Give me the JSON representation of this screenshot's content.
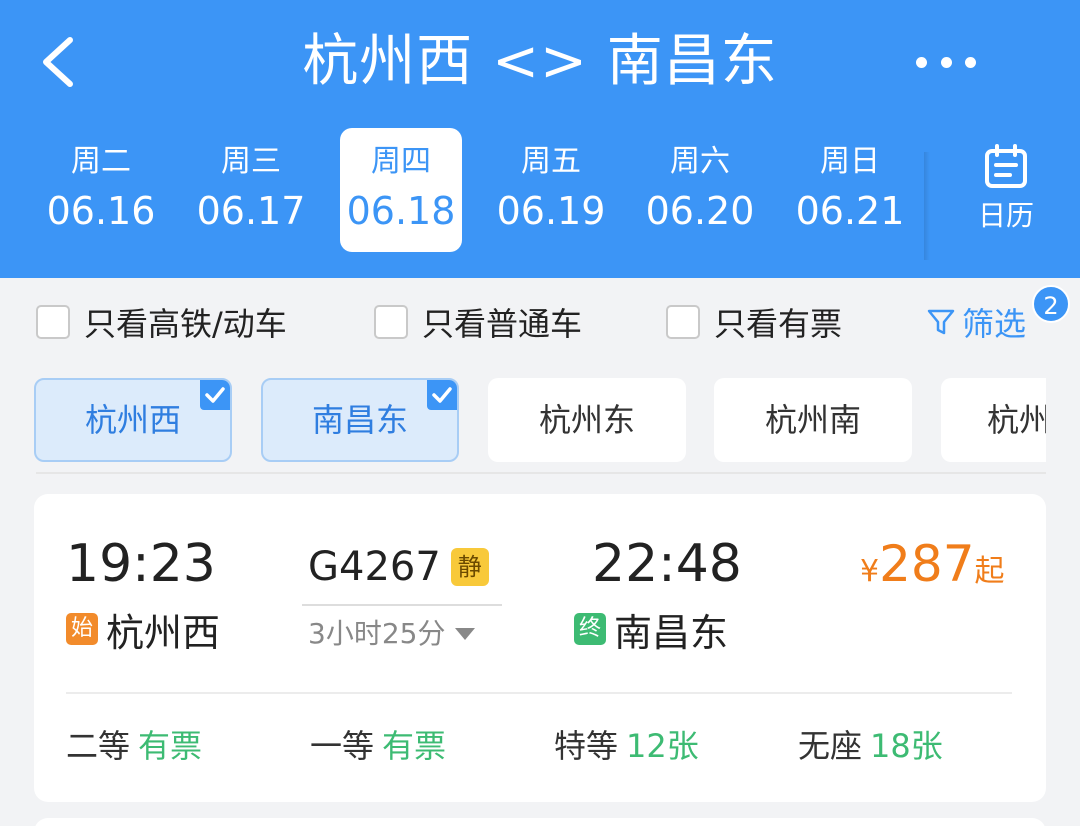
{
  "header": {
    "title": "杭州西 <> 南昌东",
    "back_icon": "chevron-left-icon",
    "more_icon": "more-horizontal-icon"
  },
  "dates": [
    {
      "weekday": "周二",
      "date": "06.16",
      "active": false
    },
    {
      "weekday": "周三",
      "date": "06.17",
      "active": false
    },
    {
      "weekday": "周四",
      "date": "06.18",
      "active": true
    },
    {
      "weekday": "周五",
      "date": "06.19",
      "active": false
    },
    {
      "weekday": "周六",
      "date": "06.20",
      "active": false
    },
    {
      "weekday": "周日",
      "date": "06.21",
      "active": false
    }
  ],
  "calendar": {
    "label": "日历",
    "icon": "calendar-icon"
  },
  "filters": {
    "high_speed": "只看高铁/动车",
    "normal": "只看普通车",
    "available": "只看有票",
    "filter_label": "筛选",
    "filter_badge": "2"
  },
  "stations": [
    {
      "name": "杭州西",
      "selected": true
    },
    {
      "name": "南昌东",
      "selected": true
    },
    {
      "name": "杭州东",
      "selected": false
    },
    {
      "name": "杭州南",
      "selected": false
    },
    {
      "name": "杭州",
      "selected": false
    }
  ],
  "train": {
    "dep_time": "19:23",
    "dep_tag": "始",
    "dep_station": "杭州西",
    "number": "G4267",
    "quiet_tag": "静",
    "duration": "3小时25分",
    "arr_time": "22:48",
    "arr_tag": "终",
    "arr_station": "南昌东",
    "price_currency": "¥",
    "price": "287",
    "price_suffix": "起",
    "seats": [
      {
        "class": "二等",
        "status": "有票"
      },
      {
        "class": "一等",
        "status": "有票"
      },
      {
        "class": "特等",
        "status": "12张"
      },
      {
        "class": "无座",
        "status": "18张"
      }
    ]
  },
  "colors": {
    "header_blue": "#3c95f6",
    "price_orange": "#f07d1a",
    "available_green": "#3dbb73"
  }
}
